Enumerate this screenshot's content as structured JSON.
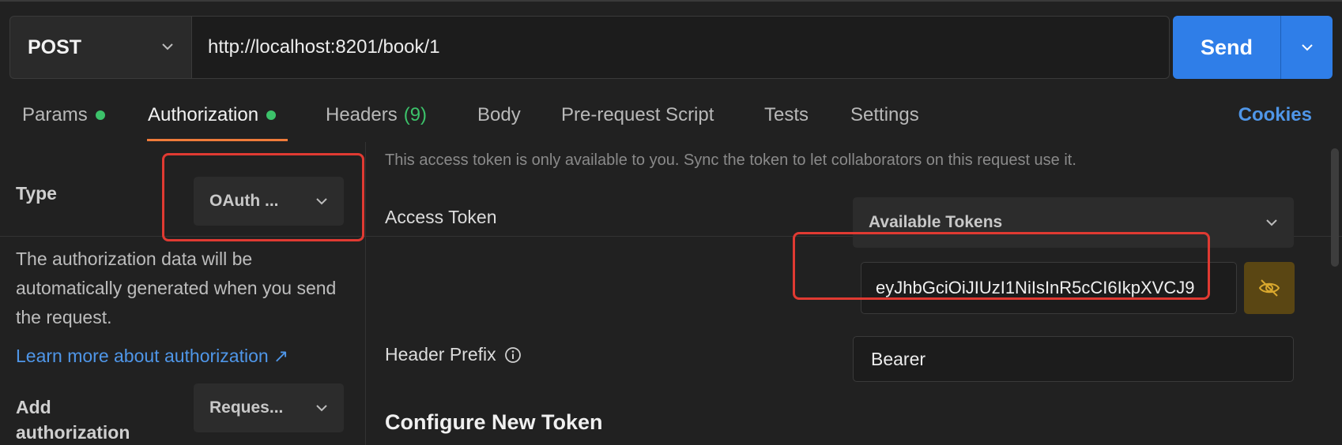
{
  "request": {
    "method": "POST",
    "url": "http://localhost:8201/book/1",
    "send_label": "Send"
  },
  "tabs": [
    {
      "label": "Params",
      "dot": true
    },
    {
      "label": "Authorization",
      "dot": true,
      "active": true
    },
    {
      "label": "Headers",
      "count": "(9)"
    },
    {
      "label": "Body"
    },
    {
      "label": "Pre-request Script"
    },
    {
      "label": "Tests"
    },
    {
      "label": "Settings"
    }
  ],
  "cookies_label": "Cookies",
  "left": {
    "type_label": "Type",
    "type_value": "OAuth ...",
    "description": "The authorization data will be automatically generated when you send the request.",
    "learn_more": "Learn more about authorization ↗",
    "add_auth_label": "Add authorization",
    "add_auth_value": "Reques..."
  },
  "right": {
    "notice": "This access token is only available to you. Sync the token to let collaborators on this request use it.",
    "access_token_label": "Access Token",
    "available_tokens": "Available Tokens",
    "token_value": "eyJhbGciOiJIUzI1NiIsInR5cCI6IkpXVCJ9",
    "header_prefix_label": "Header Prefix",
    "header_prefix_value": "Bearer",
    "configure_title": "Configure New Token"
  },
  "colors": {
    "accent_blue": "#2f7ee8",
    "tab_underline": "#f07b3a",
    "status_dot": "#3cc26a",
    "highlight": "#e03a32",
    "link": "#4f96e8"
  }
}
